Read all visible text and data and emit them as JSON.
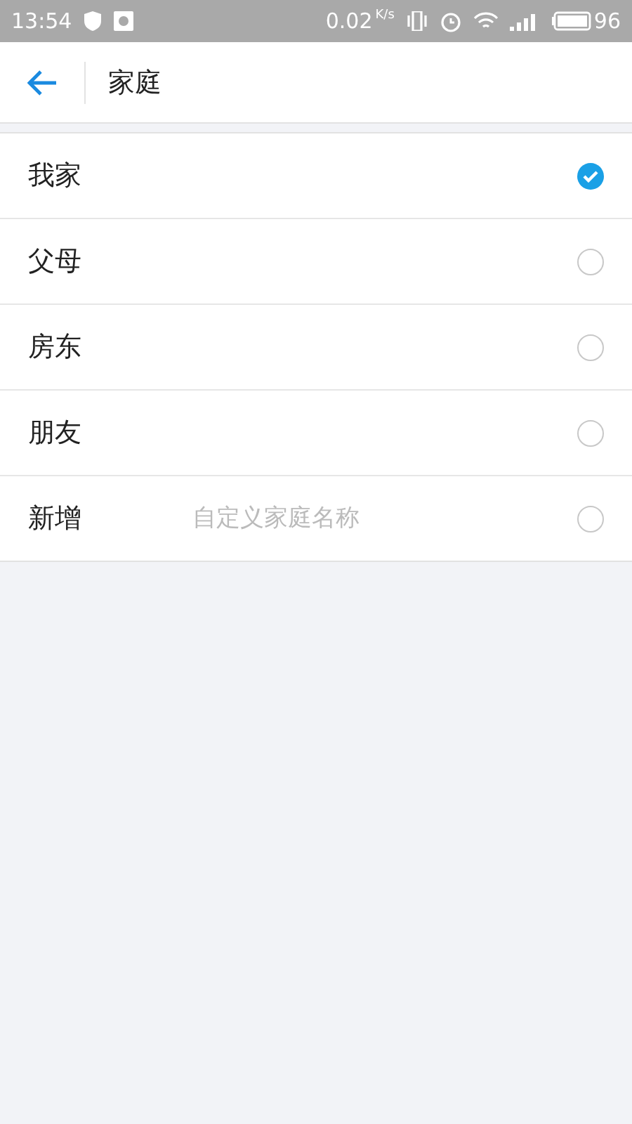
{
  "status_bar": {
    "time": "13:54",
    "speed": "0.02",
    "speed_unit": "K/s",
    "battery": "96"
  },
  "header": {
    "title": "家庭"
  },
  "options": [
    {
      "kind": "plain",
      "label": "我家",
      "selected": true
    },
    {
      "kind": "plain",
      "label": "父母",
      "selected": false
    },
    {
      "kind": "plain",
      "label": "房东",
      "selected": false
    },
    {
      "kind": "plain",
      "label": "朋友",
      "selected": false
    },
    {
      "kind": "custom",
      "label": "新增",
      "placeholder": "自定义家庭名称",
      "selected": false
    }
  ]
}
